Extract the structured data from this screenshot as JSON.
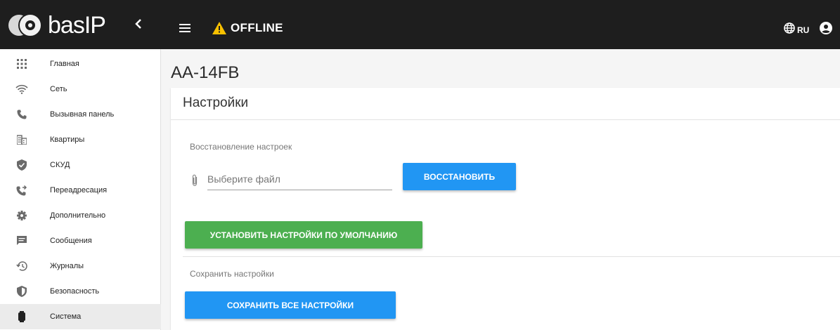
{
  "header": {
    "logo_text": "basIP",
    "collapse_glyph": "‹",
    "status_text": "OFFLINE",
    "status_icon": "warning-icon",
    "warning_color": "#f9c100",
    "language": "RU",
    "bar_color": "#1e1e1e"
  },
  "sidebar": {
    "items": [
      {
        "label": "Главная",
        "icon": "apps-icon"
      },
      {
        "label": "Сеть",
        "icon": "wifi-icon"
      },
      {
        "label": "Вызывная панель",
        "icon": "phone-icon"
      },
      {
        "label": "Квартиры",
        "icon": "building-icon"
      },
      {
        "label": "СКУД",
        "icon": "shield-check-icon"
      },
      {
        "label": "Переадресация",
        "icon": "phone-forward-icon"
      },
      {
        "label": "Дополнительно",
        "icon": "gear-icon"
      },
      {
        "label": "Сообщения",
        "icon": "message-icon"
      },
      {
        "label": "Журналы",
        "icon": "history-icon"
      },
      {
        "label": "Безопасность",
        "icon": "security-icon"
      },
      {
        "label": "Система",
        "icon": "device-icon"
      }
    ],
    "active_index": 10
  },
  "main": {
    "page_title": "AA-14FB",
    "card_title": "Настройки",
    "restore_label": "Восстановление настроек",
    "file_placeholder": "Выберите файл",
    "restore_button": "ВОССТАНОВИТЬ",
    "defaults_button": "УСТАНОВИТЬ НАСТРОЙКИ ПО УМОЛЧАНИЮ",
    "save_label": "Сохранить настройки",
    "save_button": "СОХРАНИТЬ ВСЕ НАСТРОЙКИ"
  },
  "colors": {
    "primary": "#2196f3",
    "success": "#4caf50"
  }
}
